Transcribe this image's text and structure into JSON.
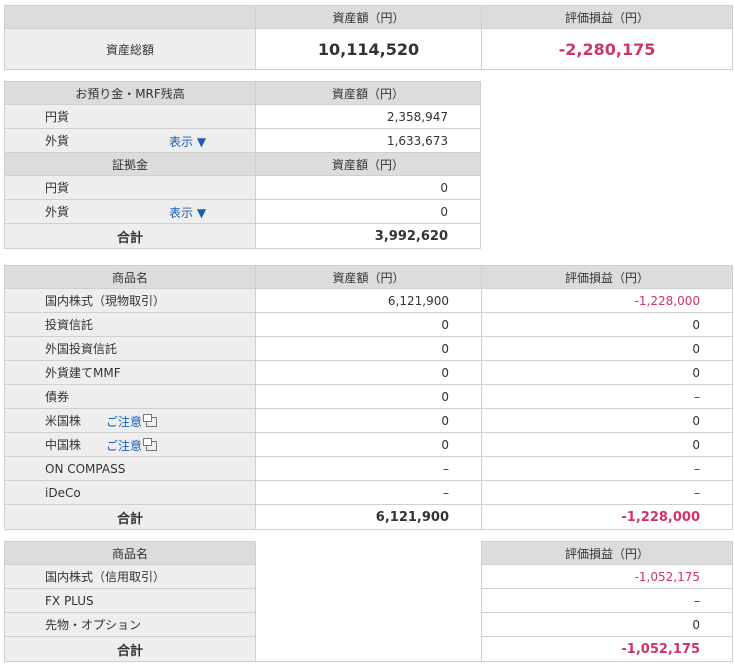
{
  "summary": {
    "col_asset": "資産額（円）",
    "col_pl": "評価損益（円）",
    "row_label": "資産総額",
    "asset_total": "10,114,520",
    "pl_total": "-2,280,175"
  },
  "deposits": {
    "header_label": "お預り金・MRF残高",
    "header_value": "資産額（円）",
    "rows": [
      {
        "label": "円貨",
        "value": "2,358,947"
      },
      {
        "label": "外貨",
        "link": "表示 ▼",
        "value": "1,633,673"
      }
    ],
    "margin_header_label": "証拠金",
    "margin_header_value": "資産額（円）",
    "margin_rows": [
      {
        "label": "円貨",
        "value": "0"
      },
      {
        "label": "外貨",
        "link": "表示 ▼",
        "value": "0"
      }
    ],
    "total_label": "合計",
    "total_value": "3,992,620"
  },
  "products": {
    "col_name": "商品名",
    "col_asset": "資産額（円）",
    "col_pl": "評価損益（円）",
    "rows": [
      {
        "label": "国内株式（現物取引）",
        "asset": "6,121,900",
        "pl": "-1,228,000"
      },
      {
        "label": "投資信託",
        "asset": "0",
        "pl": "0"
      },
      {
        "label": "外国投資信託",
        "asset": "0",
        "pl": "0"
      },
      {
        "label": "外貨建てMMF",
        "asset": "0",
        "pl": "0"
      },
      {
        "label": "債券",
        "asset": "0",
        "pl": "–"
      },
      {
        "label": "米国株",
        "link": "ご注意",
        "asset": "0",
        "pl": "0"
      },
      {
        "label": "中国株",
        "link": "ご注意",
        "asset": "0",
        "pl": "0"
      },
      {
        "label": "ON COMPASS",
        "asset": "–",
        "pl": "–"
      },
      {
        "label": "iDeCo",
        "asset": "–",
        "pl": "–"
      }
    ],
    "total_label": "合計",
    "total_asset": "6,121,900",
    "total_pl": "-1,228,000"
  },
  "margin": {
    "col_name": "商品名",
    "col_pl": "評価損益（円）",
    "rows": [
      {
        "label": "国内株式（信用取引）",
        "pl": "-1,052,175"
      },
      {
        "label": "FX PLUS",
        "pl": "–"
      },
      {
        "label": "先物・オプション",
        "pl": "0"
      }
    ],
    "total_label": "合計",
    "total_pl": "-1,052,175"
  }
}
